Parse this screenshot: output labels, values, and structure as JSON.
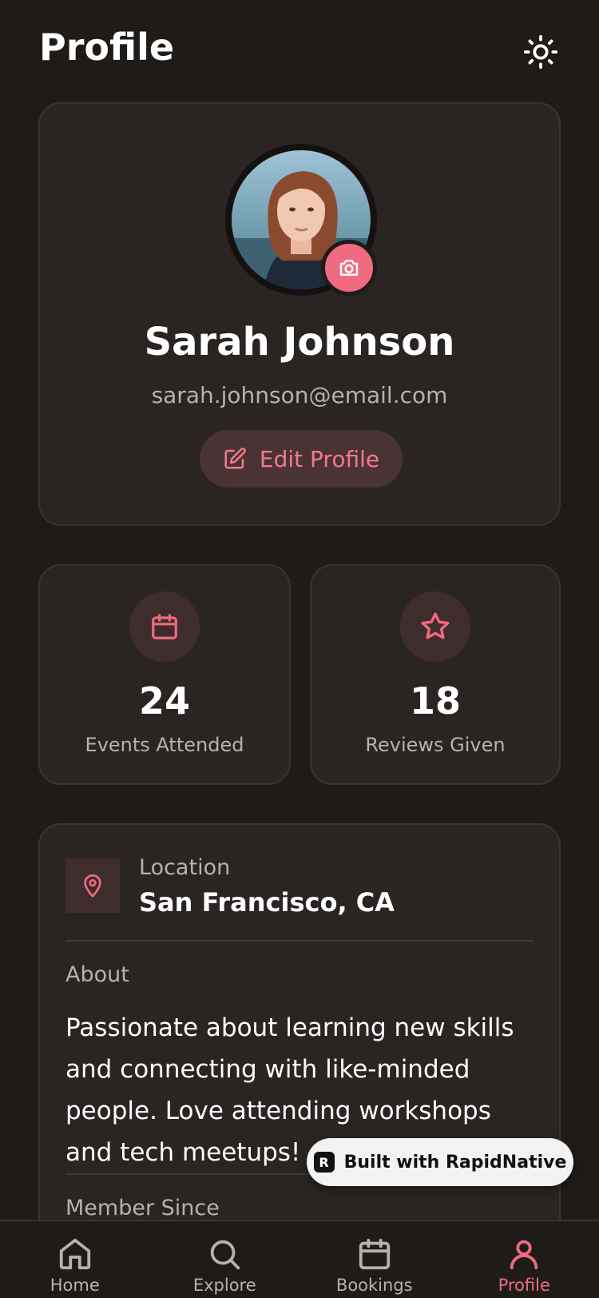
{
  "header": {
    "title": "Profile",
    "theme_icon": "sun-icon"
  },
  "profile": {
    "name": "Sarah Johnson",
    "email": "sarah.johnson@email.com",
    "edit_label": "Edit Profile",
    "camera_icon": "camera-icon"
  },
  "stats": [
    {
      "value": "24",
      "label": "Events Attended",
      "icon": "calendar-icon"
    },
    {
      "value": "18",
      "label": "Reviews Given",
      "icon": "star-icon"
    }
  ],
  "info": {
    "location_label": "Location",
    "location_value": "San Francisco, CA",
    "about_label": "About",
    "about_text": "Passionate about learning new skills and connecting with like-minded people. Love attending workshops and tech meetups!",
    "member_label": "Member Since"
  },
  "badge": {
    "label": "Built with RapidNative"
  },
  "nav": [
    {
      "label": "Home",
      "icon": "home-icon"
    },
    {
      "label": "Explore",
      "icon": "search-icon"
    },
    {
      "label": "Bookings",
      "icon": "calendar-icon"
    },
    {
      "label": "Profile",
      "icon": "user-icon",
      "active": true
    }
  ],
  "colors": {
    "accent": "#f06b7f",
    "background": "#1f1b19",
    "card": "#2a2523"
  }
}
